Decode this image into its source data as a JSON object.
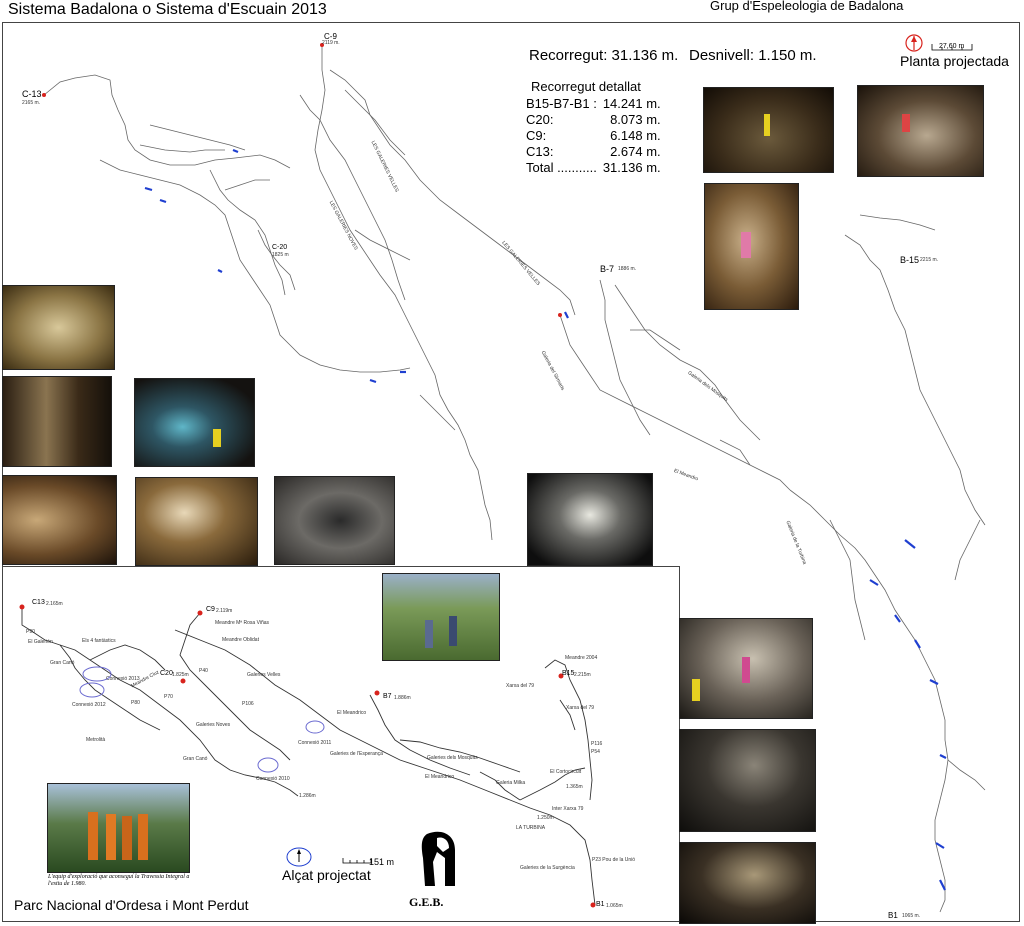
{
  "header": {
    "title": "Sistema Badalona  o  Sistema d'Escuain 2013",
    "org": "Grup d'Espeleologia de Badalona"
  },
  "stats": {
    "recorregut": "Recorregut: 31.136 m.",
    "desnivell": "Desnivell:  1.150 m.",
    "detall_title": "Recorregut detallat",
    "rows": [
      {
        "name": "B15-B7-B1 :",
        "value": "14.241 m."
      },
      {
        "name": "C20:",
        "value": "8.073 m."
      },
      {
        "name": "C9:",
        "value": "6.148 m."
      },
      {
        "name": "C13:",
        "value": "2.674 m."
      },
      {
        "name": "Total  ...........",
        "value": "31.136 m."
      }
    ]
  },
  "plan": {
    "label": "Planta projectada",
    "scale": "27,60 m",
    "entrances": [
      {
        "name": "C-13",
        "alt": "2165 m."
      },
      {
        "name": "C-9",
        "alt": "2119 m."
      },
      {
        "name": "C-20",
        "alt": "1825 m"
      },
      {
        "name": "B-7",
        "alt": "1886 m."
      },
      {
        "name": "B-15",
        "alt": "2215 m."
      },
      {
        "name": "B1",
        "alt": "1065 m."
      }
    ],
    "galleries": [
      "LES GALERIES VELLES",
      "LES GALERIES NOVES",
      "LES GALERIES VELLES",
      "Galeria dels Mosquits",
      "El Meandro",
      "Galeria del Sirmaris",
      "Galeria de la Turbina"
    ]
  },
  "elevation": {
    "label": "Alçat projectat",
    "scale": "151 m",
    "footer": "Parc Nacional  d'Ordesa i Mont Perdut",
    "caption": "L'equip d'exploració que aconseguí la Travessia Integral a l'estiu de 1.980.",
    "logo_text": "G.E.B.",
    "entrances": [
      {
        "name": "C13",
        "alt": "2.165m"
      },
      {
        "name": "C9",
        "alt": "2.119m"
      },
      {
        "name": "C20",
        "alt": "1.825m"
      },
      {
        "name": "B7",
        "alt": "1.886m"
      },
      {
        "name": "B15",
        "alt": "2.215m"
      },
      {
        "name": "B1",
        "alt": "1.065m"
      }
    ],
    "labels": [
      "P90",
      "El Galerión",
      "Els 4 fantàstics",
      "Gran Canó",
      "Connexió 2013",
      "Connexió 2012",
      "Meandre Cluz",
      "P80",
      "P70",
      "P40",
      "P106",
      "Meandre Mª Rosa Viñas",
      "Meandre Oblidat",
      "Galeries Velles",
      "Galeries Noves",
      "Metrolità",
      "Gran Canó",
      "Connexió 2010",
      "1.286m",
      "Connexió 2011",
      "Galeries de l'Esperança",
      "El Meandrico",
      "El Meandrico",
      "Galeries dels Mosquits",
      "Galeria Milka",
      "Meandre 2004",
      "Xarxa del 79",
      "Xarxa del 79",
      "P116",
      "P54",
      "El Cortocircuit",
      "1.365m",
      "Inter Xarxa 79",
      "1.250m",
      "LA TURBINA",
      "P23 Pou de la Unió",
      "Galeries de la Surgència"
    ]
  },
  "colors": {
    "red_marker": "#d8231d",
    "blue_marker": "#1f3fd0",
    "connexio_ring": "#6a6ad0"
  }
}
